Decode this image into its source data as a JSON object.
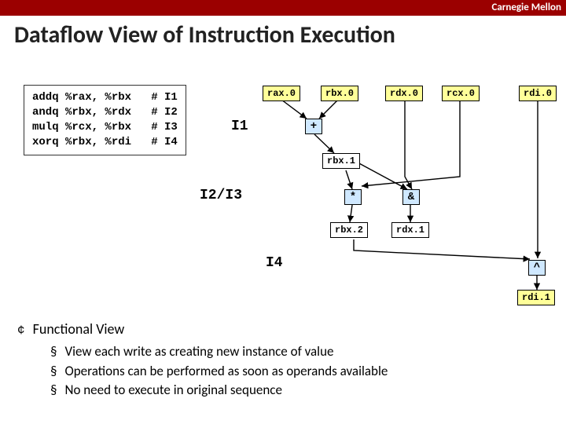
{
  "brand": "Carnegie Mellon",
  "title": "Dataflow View of Instruction Execution",
  "code": "addq %rax, %rbx   # I1\nandq %rbx, %rdx   # I2\nmulq %rcx, %rbx   # I3\nxorq %rbx, %rdi   # I4",
  "labels": {
    "i1": "I1",
    "i23": "I2/I3",
    "i4": "I4"
  },
  "regs": {
    "rax0": "rax.0",
    "rbx0": "rbx.0",
    "rdx0": "rdx.0",
    "rcx0": "rcx.0",
    "rdi0": "rdi.0",
    "rbx1": "rbx.1",
    "rbx2": "rbx.2",
    "rdx1": "rdx.1",
    "rdi1": "rdi.1"
  },
  "ops": {
    "add": "+",
    "and": "&",
    "mul": "*",
    "xor": "^"
  },
  "section": "Functional View",
  "points": [
    "View each write as creating new instance of value",
    "Operations can be performed as soon as operands available",
    "No need to execute in original sequence"
  ]
}
